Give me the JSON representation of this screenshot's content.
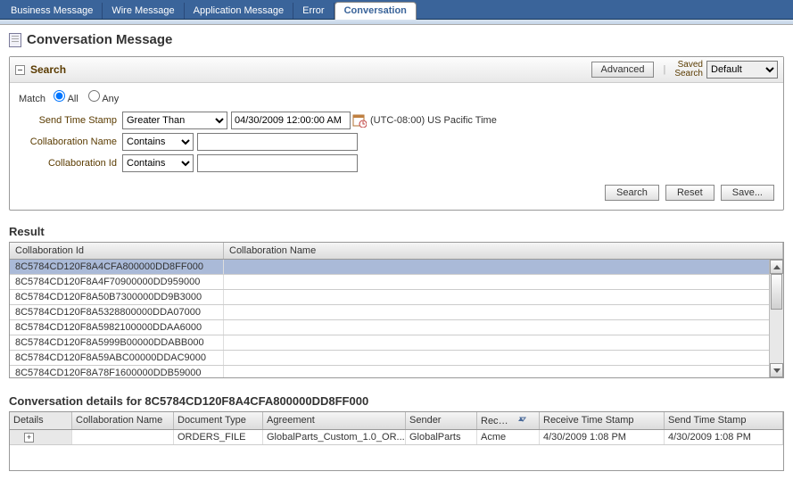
{
  "tabs": {
    "items": [
      {
        "label": "Business Message"
      },
      {
        "label": "Wire Message"
      },
      {
        "label": "Application Message"
      },
      {
        "label": "Error"
      },
      {
        "label": "Conversation"
      }
    ],
    "active_index": 4
  },
  "page_title": "Conversation Message",
  "search": {
    "title": "Search",
    "advanced_label": "Advanced",
    "saved_label_line1": "Saved",
    "saved_label_line2": "Search",
    "saved_select_value": "Default",
    "match_label": "Match",
    "match_all": "All",
    "match_any": "Any",
    "match_value": "All",
    "fields": {
      "send_time_stamp": {
        "label": "Send Time Stamp",
        "operator": "Greater Than",
        "value": "04/30/2009 12:00:00 AM",
        "tz": "(UTC-08:00) US Pacific Time"
      },
      "collab_name": {
        "label": "Collaboration Name",
        "operator": "Contains",
        "value": ""
      },
      "collab_id": {
        "label": "Collaboration Id",
        "operator": "Contains",
        "value": ""
      }
    },
    "buttons": {
      "search": "Search",
      "reset": "Reset",
      "save": "Save..."
    }
  },
  "result": {
    "title": "Result",
    "columns": {
      "id": "Collaboration Id",
      "name": "Collaboration Name"
    },
    "rows": [
      {
        "id": "8C5784CD120F8A4CFA800000DD8FF000",
        "name": ""
      },
      {
        "id": "8C5784CD120F8A4F70900000DD959000",
        "name": ""
      },
      {
        "id": "8C5784CD120F8A50B7300000DD9B3000",
        "name": ""
      },
      {
        "id": "8C5784CD120F8A5328800000DDA07000",
        "name": ""
      },
      {
        "id": "8C5784CD120F8A5982100000DDAA6000",
        "name": ""
      },
      {
        "id": "8C5784CD120F8A5999B00000DDABB000",
        "name": ""
      },
      {
        "id": "8C5784CD120F8A59ABC00000DDAC9000",
        "name": ""
      },
      {
        "id": "8C5784CD120F8A78F1600000DDB59000",
        "name": ""
      }
    ],
    "selected_index": 0
  },
  "details": {
    "title_prefix": "Conversation details for ",
    "title_id": "8C5784CD120F8A4CFA800000DD8FF000",
    "columns": {
      "details": "Details",
      "cname": "Collaboration Name",
      "doctype": "Document Type",
      "agreement": "Agreement",
      "sender": "Sender",
      "receiver": "Receiver",
      "rts": "Receive Time Stamp",
      "sts": "Send Time Stamp"
    },
    "row": {
      "cname": "",
      "doctype": "ORDERS_FILE",
      "agreement": "GlobalParts_Custom_1.0_OR...",
      "sender": "GlobalParts",
      "receiver": "Acme",
      "rts": "4/30/2009 1:08 PM",
      "sts": "4/30/2009 1:08 PM"
    }
  }
}
